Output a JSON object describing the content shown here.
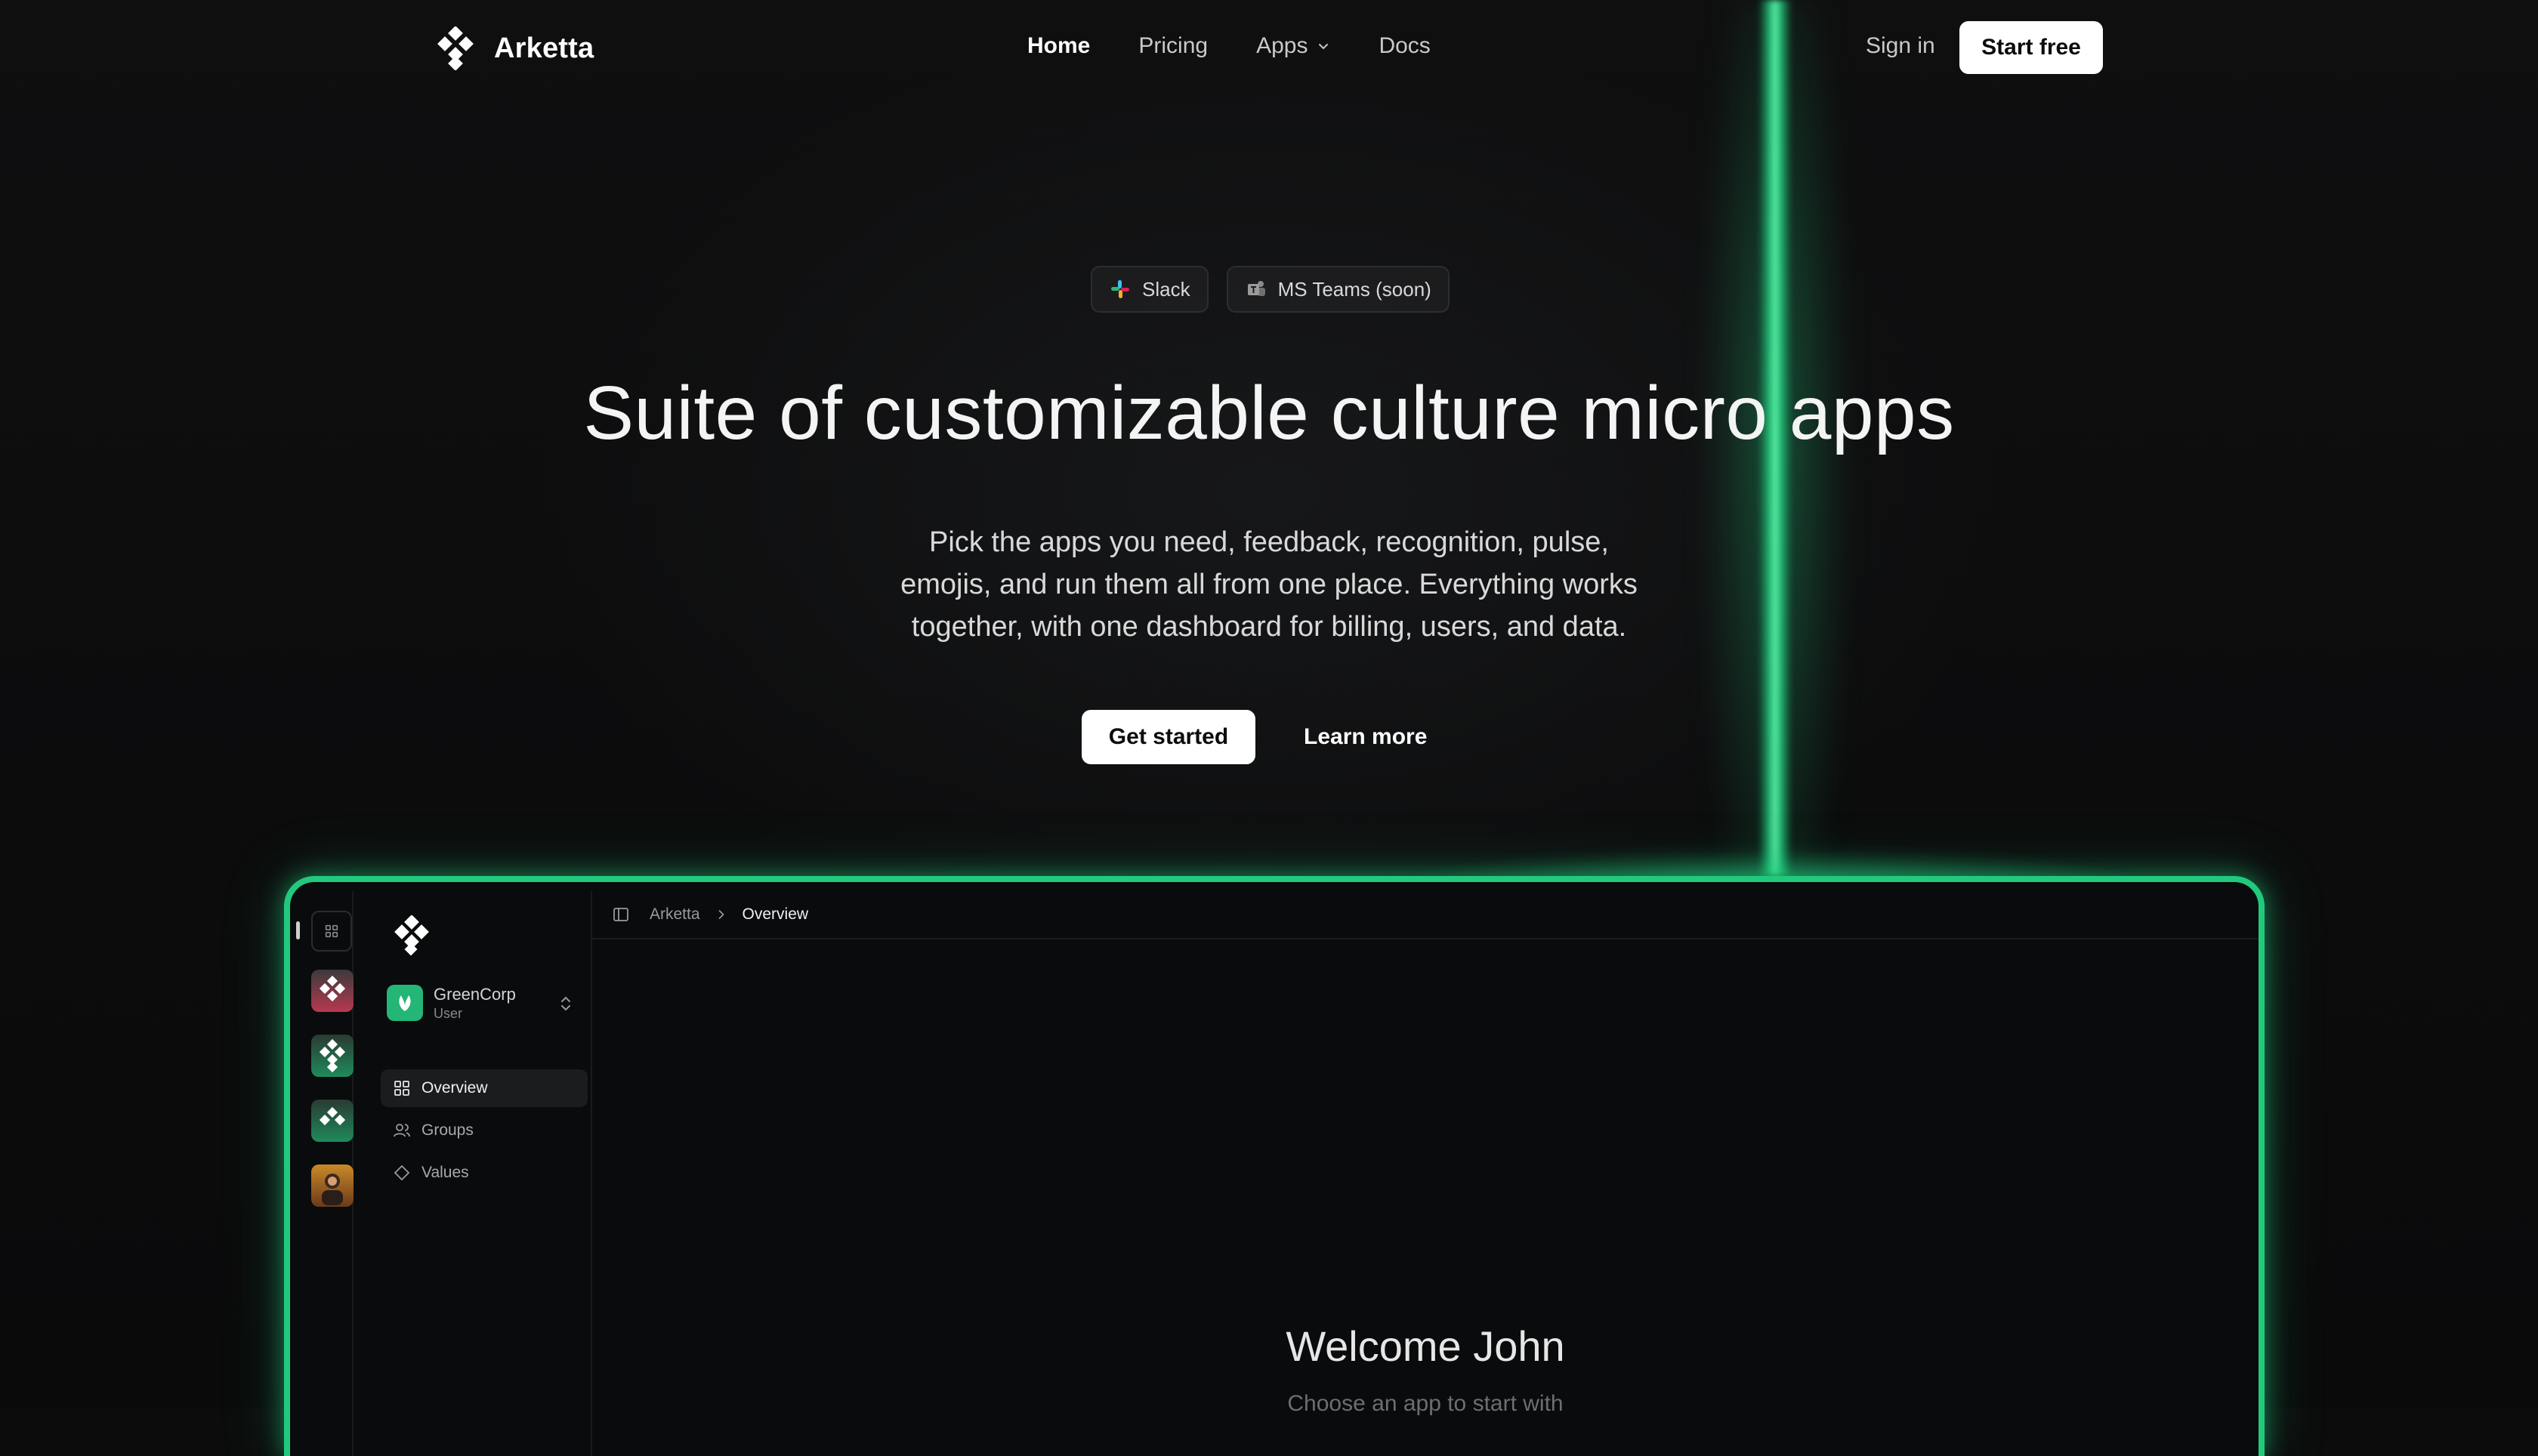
{
  "brand": {
    "name": "Arketta",
    "accent": "#22c97d"
  },
  "nav": {
    "links": [
      {
        "label": "Home",
        "active": true
      },
      {
        "label": "Pricing",
        "active": false
      },
      {
        "label": "Apps",
        "active": false,
        "has_dropdown": true,
        "icon": "chevron-down-icon"
      },
      {
        "label": "Docs",
        "active": false
      }
    ],
    "sign_in": "Sign in",
    "start_free": "Start free"
  },
  "hero": {
    "pills": [
      {
        "label": "Slack",
        "icon": "slack-icon"
      },
      {
        "label": "MS Teams (soon)",
        "icon": "ms-teams-icon"
      }
    ],
    "headline": "Suite of customizable culture micro apps",
    "subtext": "Pick the apps you need, feedback, recognition, pulse, emojis, and run them all from one place. Everything works together, with one dashboard for billing, users, and data.",
    "cta_primary": "Get started",
    "cta_secondary": "Learn more"
  },
  "app_preview": {
    "rail_apps": [
      {
        "name": "app-1",
        "color": "#b8394f"
      },
      {
        "name": "app-2",
        "color": "#1f8a5a"
      },
      {
        "name": "app-3",
        "color": "#1f8a5a"
      },
      {
        "name": "app-4",
        "color": "#c98a28"
      }
    ],
    "org": {
      "name": "GreenCorp",
      "role": "User"
    },
    "sidebar_items": [
      {
        "label": "Overview",
        "icon": "grid-icon",
        "active": true
      },
      {
        "label": "Groups",
        "icon": "users-icon",
        "active": false
      },
      {
        "label": "Values",
        "icon": "diamond-icon",
        "active": false
      }
    ],
    "breadcrumb": {
      "root": "Arketta",
      "current": "Overview"
    },
    "welcome_title": "Welcome John",
    "welcome_subtitle": "Choose an app to start with"
  }
}
